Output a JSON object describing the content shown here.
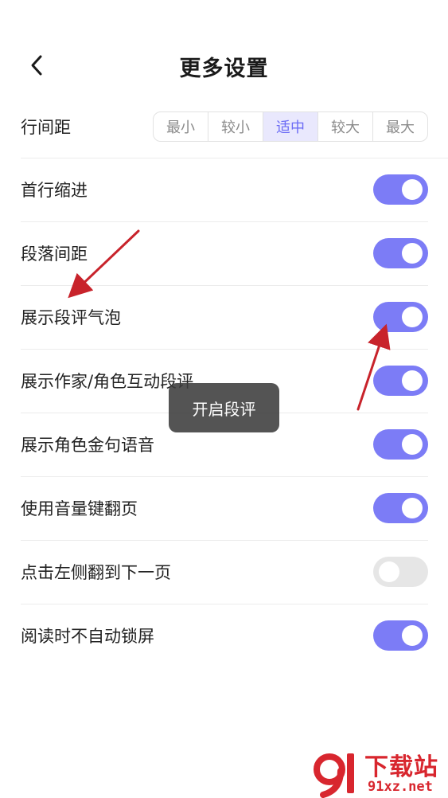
{
  "header": {
    "title": "更多设置",
    "back_icon": "chevron-left-icon"
  },
  "line_spacing": {
    "label": "行间距",
    "options": [
      "最小",
      "较小",
      "适中",
      "较大",
      "最大"
    ],
    "selected": "适中"
  },
  "settings": [
    {
      "label": "首行缩进",
      "enabled": true
    },
    {
      "label": "段落间距",
      "enabled": true
    },
    {
      "label": "展示段评气泡",
      "enabled": true
    },
    {
      "label": "展示作家/角色互动段评",
      "enabled": true
    },
    {
      "label": "展示角色金句语音",
      "enabled": true
    },
    {
      "label": "使用音量键翻页",
      "enabled": true
    },
    {
      "label": "点击左侧翻到下一页",
      "enabled": false
    },
    {
      "label": "阅读时不自动锁屏",
      "enabled": true
    }
  ],
  "toast": {
    "text": "开启段评"
  },
  "watermark": {
    "title": "下载站",
    "url": "91xz.net"
  },
  "colors": {
    "accent": "#7c7cf6",
    "toggle_off": "#e6e6e6",
    "segment_active_bg": "#e9e8fd",
    "annotation_arrow": "#c8232b",
    "watermark": "#d8262e"
  }
}
